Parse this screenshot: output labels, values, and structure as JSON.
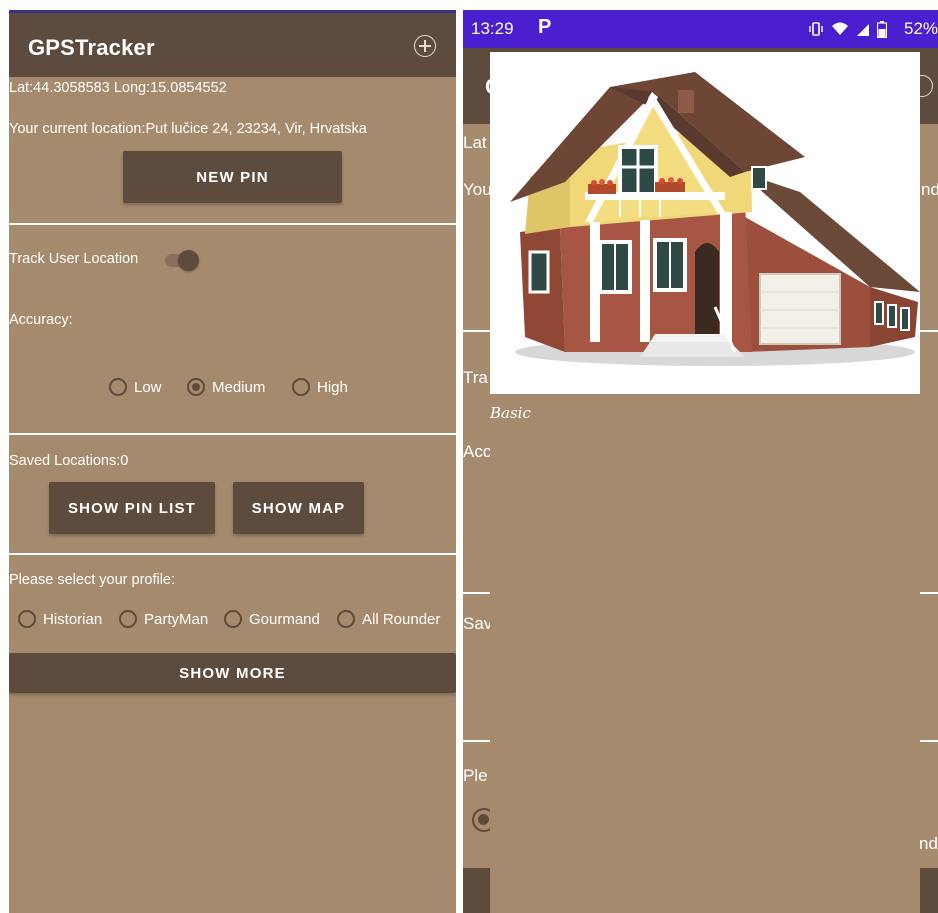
{
  "left": {
    "app_title": "GPSTracker",
    "add_icon": "add-circle-icon",
    "coordinates": "Lat:44.3058583  Long:15.0854552",
    "current_location": "Your current location:Put lučice 24, 23234, Vir, Hrvatska",
    "new_pin_label": "NEW PIN",
    "track_user_location_label": "Track User Location",
    "track_user_location_on": true,
    "accuracy_label": "Accuracy:",
    "accuracy_options": [
      {
        "label": "Low",
        "selected": false
      },
      {
        "label": "Medium",
        "selected": true
      },
      {
        "label": "High",
        "selected": false
      }
    ],
    "saved_locations": "Saved Locations:0",
    "show_pin_list_label": "SHOW PIN LIST",
    "show_map_label": "SHOW MAP",
    "profile_prompt": "Please select your profile:",
    "profile_options": [
      {
        "label": "Historian",
        "selected": false
      },
      {
        "label": "PartyMan",
        "selected": false
      },
      {
        "label": "Gourmand",
        "selected": false
      },
      {
        "label": "All Rounder",
        "selected": false
      }
    ],
    "show_more_label": "SHOW MORE"
  },
  "right": {
    "status_time": "13:29",
    "status_app_icon": "P",
    "status_icons": "vibrate-icon wifi-icon signal-icon battery-icon",
    "battery": "52%",
    "bg_fragments": {
      "appbar_letter": "G",
      "lat": "Lat",
      "you": "You",
      "nd": "nd",
      "tra": "Tra",
      "acc": "Acc",
      "sav": "Sav",
      "ple": "Ple",
      "nde": "nde"
    },
    "dialog": {
      "image": "house-illustration",
      "caption": "Basic"
    }
  },
  "colors": {
    "background": "#a68a6d",
    "primary_dark": "#5d4b3d",
    "status_bar": "#4a1fd0",
    "divider": "#ffffff"
  }
}
